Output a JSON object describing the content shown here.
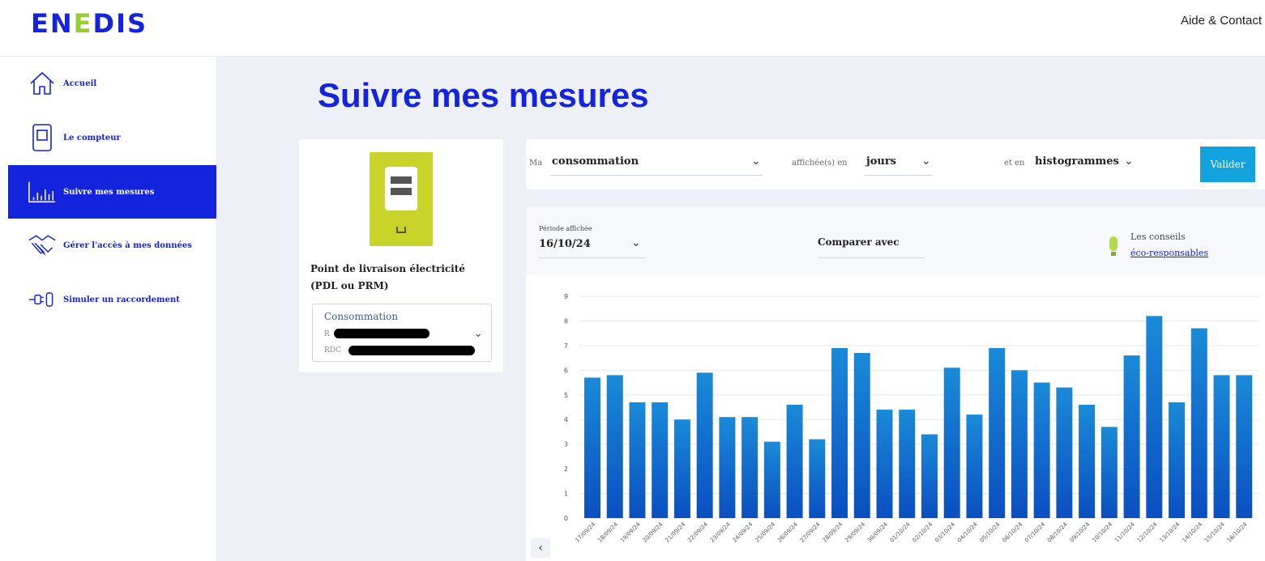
{
  "header": {
    "logo": "ENEDIS",
    "help_link": "Aide & Contact"
  },
  "sidebar": {
    "items": [
      {
        "label": "Accueil",
        "icon": "home-icon",
        "active": false
      },
      {
        "label": "Le compteur",
        "icon": "meter-icon",
        "active": false
      },
      {
        "label": "Suivre mes mesures",
        "icon": "chart-icon",
        "active": true
      },
      {
        "label": "Gérer l'accès à mes données",
        "icon": "handshake-icon",
        "active": false
      },
      {
        "label": "Simuler un raccordement",
        "icon": "plug-icon",
        "active": false
      }
    ]
  },
  "main": {
    "title": "Suivre mes mesures",
    "pdl": {
      "label": "Point de livraison électricité (PDL ou PRM)",
      "select_title": "Consommation",
      "prefix_1": "R",
      "prefix_2": "RDC"
    },
    "filters": {
      "prefix_ma": "Ma",
      "measure": "consommation",
      "displayed_in": "affichée(s) en",
      "unit": "jours",
      "and_in": "et en",
      "mode": "histogrammes",
      "validate": "Valider"
    },
    "chart_panel": {
      "period_label": "Période affichée",
      "period_value": "16/10/24",
      "compare": "Comparer avec",
      "tips_line1": "Les conseils",
      "tips_line2": "éco-responsables",
      "prev_icon": "chevron-left-icon"
    }
  },
  "colors": {
    "brand_blue": "#1423dc",
    "bar_top": "#1a8ad8",
    "bar_bottom": "#0a4fc0",
    "validate_button": "#12a3de",
    "meter_yellow": "#c8d42a"
  },
  "chart_data": {
    "type": "bar",
    "categories": [
      "17/09/24",
      "18/09/24",
      "19/09/24",
      "20/09/24",
      "21/09/24",
      "22/09/24",
      "23/09/24",
      "24/09/24",
      "25/09/24",
      "26/09/24",
      "27/09/24",
      "28/09/24",
      "29/09/24",
      "30/09/24",
      "01/10/24",
      "02/10/24",
      "03/10/24",
      "04/10/24",
      "05/10/24",
      "06/10/24",
      "07/10/24",
      "08/10/24",
      "09/10/24",
      "10/10/24",
      "11/10/24",
      "12/10/24",
      "13/10/24",
      "14/10/24",
      "15/10/24",
      "16/10/24"
    ],
    "values": [
      5.7,
      5.8,
      4.7,
      4.7,
      4.0,
      5.9,
      4.1,
      4.1,
      3.1,
      4.6,
      3.2,
      6.9,
      6.7,
      4.4,
      4.4,
      3.4,
      6.1,
      4.2,
      6.9,
      6.0,
      5.5,
      5.3,
      4.6,
      3.7,
      6.6,
      8.2,
      4.7,
      7.7,
      5.8,
      5.8
    ],
    "yticks": [
      0,
      1,
      2,
      3,
      4,
      5,
      6,
      7,
      8,
      9
    ],
    "ylim": [
      0,
      9
    ],
    "grid": true
  }
}
